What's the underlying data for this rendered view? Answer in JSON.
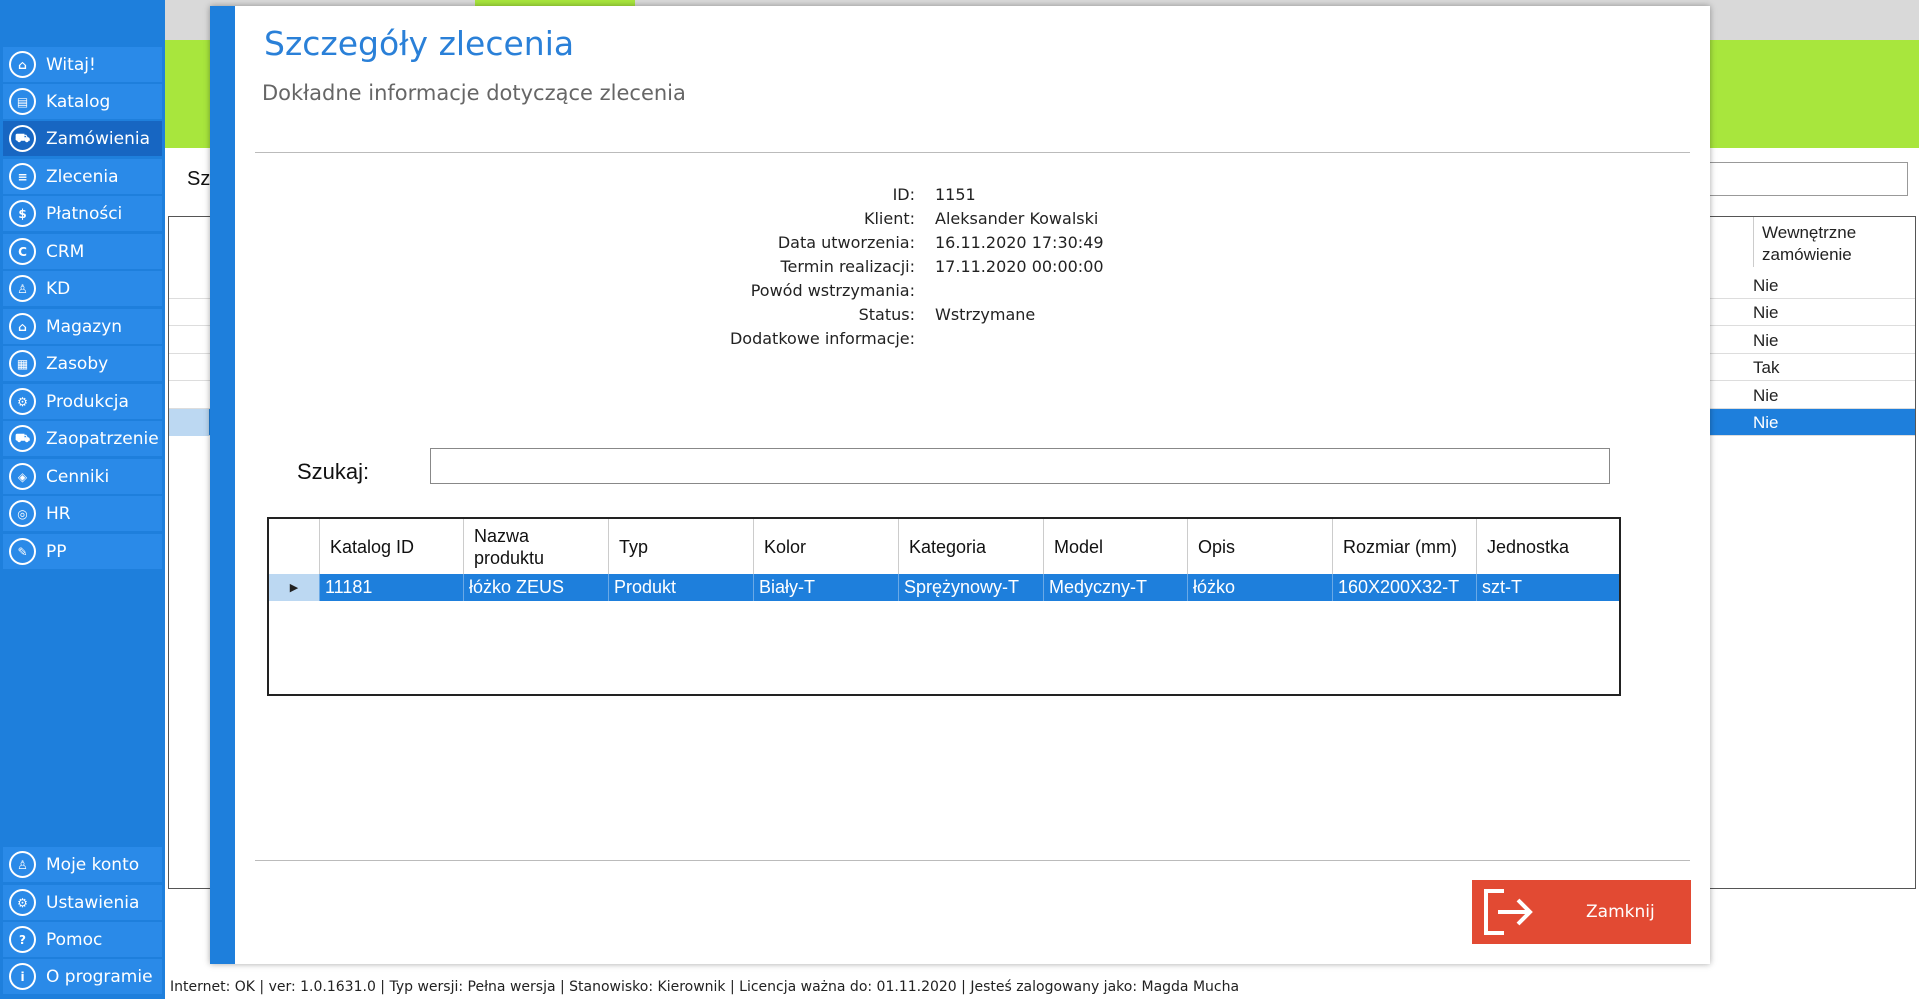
{
  "sidebar": {
    "items": [
      {
        "label": "Witaj!",
        "icon": "home-icon",
        "glyph": "⌂"
      },
      {
        "label": "Katalog",
        "icon": "book-icon",
        "glyph": "▤"
      },
      {
        "label": "Zamówienia",
        "icon": "cart-icon",
        "glyph": "⛟",
        "active": true
      },
      {
        "label": "Zlecenia",
        "icon": "list-icon",
        "glyph": "≡"
      },
      {
        "label": "Płatności",
        "icon": "dollar-icon",
        "glyph": "$"
      },
      {
        "label": "CRM",
        "icon": "crm-icon",
        "glyph": "C"
      },
      {
        "label": "KD",
        "icon": "person-icon",
        "glyph": "♙"
      },
      {
        "label": "Magazyn",
        "icon": "warehouse-icon",
        "glyph": "⌂"
      },
      {
        "label": "Zasoby",
        "icon": "resources-icon",
        "glyph": "▦"
      },
      {
        "label": "Produkcja",
        "icon": "production-icon",
        "glyph": "⚙"
      },
      {
        "label": "Zaopatrzenie",
        "icon": "truck-icon",
        "glyph": "⛟"
      },
      {
        "label": "Cenniki",
        "icon": "tag-icon",
        "glyph": "◈"
      },
      {
        "label": "HR",
        "icon": "hr-icon",
        "glyph": "◎"
      },
      {
        "label": "PP",
        "icon": "pp-icon",
        "glyph": "✎"
      }
    ],
    "bottom_items": [
      {
        "label": "Moje konto",
        "icon": "account-icon",
        "glyph": "♙"
      },
      {
        "label": "Ustawienia",
        "icon": "settings-icon",
        "glyph": "⚙"
      },
      {
        "label": "Pomoc",
        "icon": "help-icon",
        "glyph": "?"
      },
      {
        "label": "O programie",
        "icon": "info-icon",
        "glyph": "i"
      }
    ]
  },
  "background": {
    "title_fragment": "Sz",
    "column_header": "Wewnętrzne zamówienie",
    "rows": [
      "Nie",
      "Nie",
      "Nie",
      "Tak",
      "Nie",
      "Nie"
    ]
  },
  "modal": {
    "title": "Szczegóły zlecenia",
    "subtitle": "Dokładne informacje dotyczące zlecenia",
    "details": [
      {
        "key": "ID:",
        "value": "1151"
      },
      {
        "key": "Klient:",
        "value": "Aleksander Kowalski"
      },
      {
        "key": "Data utworzenia:",
        "value": "16.11.2020 17:30:49"
      },
      {
        "key": "Termin realizacji:",
        "value": "17.11.2020 00:00:00"
      },
      {
        "key": "Powód wstrzymania:",
        "value": ""
      },
      {
        "key": "Status:",
        "value": "Wstrzymane"
      },
      {
        "key": "Dodatkowe informacje:",
        "value": ""
      }
    ],
    "search_label": "Szukaj:",
    "search_value": "",
    "grid": {
      "headers": [
        "Katalog ID",
        "Nazwa produktu",
        "Typ",
        "Kolor",
        "Kategoria",
        "Model",
        "Opis",
        "Rozmiar (mm)",
        "Jednostka"
      ],
      "rows": [
        [
          "11181",
          "łóżko ZEUS",
          "Produkt",
          "Biały-T",
          "Sprężynowy-T",
          "Medyczny-T",
          "łóżko",
          "160X200X32-T",
          "szt-T"
        ]
      ]
    },
    "close_label": "Zamknij"
  },
  "statusbar": {
    "text": "Internet: OK  |   ver: 1.0.1631.0   |   Typ wersji: Pełna wersja   |   Stanowisko: Kierownik   |   Licencja ważna do: 01.11.2020  |   Jesteś zalogowany jako: Magda Mucha"
  },
  "colors": {
    "sidebar": "#1e7fdc",
    "accent_green": "#a8e63d",
    "selection": "#1e7fdc",
    "close_button": "#e24a33",
    "title_blue": "#2a80d8"
  }
}
